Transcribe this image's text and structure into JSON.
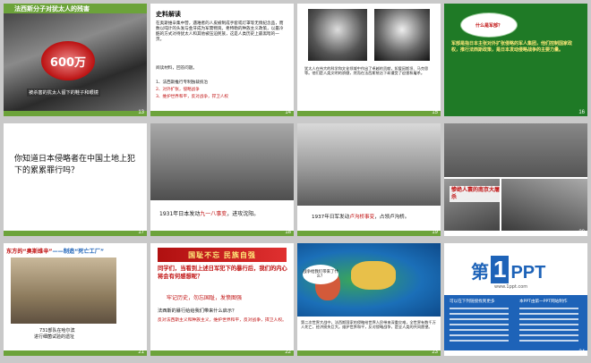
{
  "slides": [
    {
      "num": "13",
      "header": "法西斯分子对犹太人的残害",
      "badge": "600万",
      "caption": "被杀害的犹太人留下的鞋子和眼镜"
    },
    {
      "num": "14",
      "title": "史料解读",
      "para": "在奥斯维辛集中营，遇难者的人皮被制成手套或灯罩等无情纪念品，而数以吨计的头发与金牙成为军需物资。希特勒的种族主义政策，以最冷酷的方式对待犹太人和其他被压迫民族，这是人类历史上最黑暗的一页。",
      "question": "阅读材料，回答问题。",
      "items": [
        "1、法西斯推行专制独裁统治",
        "2、对外扩张，侵略战争",
        "3、维护世界和平，反对战争，捍卫人权"
      ]
    },
    {
      "num": "15",
      "para": "犹太人在伟大的科学和文化领域中作出了卓越的贡献，如爱因斯坦、马克思等。他们是人类文明的骄傲，然而在法西斯统治下却遭受了迫害和屠杀。"
    },
    {
      "num": "16",
      "bubble": "什么是军部？",
      "para": "军部是指日本主张对外扩张侵略的军人集团，他们控制国家政权，推行法西斯政策，是日本发动侵略战争的主要力量。"
    },
    {
      "num": "17",
      "text": "你知道日本侵略者在中国土地上犯下的累累罪行吗？"
    },
    {
      "num": "18",
      "caption_pre": "1931年日本发动",
      "caption_red": "九一八事变",
      "caption_post": "，进攻沈阳。"
    },
    {
      "num": "19",
      "caption_pre": "1937年日军发动",
      "caption_red": "卢沟桥事变",
      "caption_post": "，占领卢沟桥。"
    },
    {
      "num": "20",
      "label": "惨绝人寰的南京大屠杀"
    },
    {
      "num": "21",
      "title_a": "东方的“奥斯维辛”",
      "title_b": "——制造“死亡工厂”",
      "caption1": "731部队在哈尔滨",
      "caption2": "进行细菌试验的遗址"
    },
    {
      "num": "22",
      "banner": "国耻不忘 民族自强",
      "q1": "同学们，当看到上述日军犯下的暴行后，我们的内心将会有何感想呢？",
      "q2": "牢记历史，勿忘国耻，发愤图强",
      "q3": "法西斯的暴行给给我们带来什么启示？",
      "answer": "反对法西斯主义和种族主义，维护世界和平，反对战争，捍卫人权。"
    },
    {
      "num": "23",
      "bubble": "战争给我们带来了什么？",
      "para": "第二次世界大战中，法西斯国家的侵略给世界人民带来深重灾难，全世界有数千万人死亡，经济损失巨大。维护世界和平，反对侵略战争，是全人类的共同愿望。"
    },
    {
      "num": "24",
      "logo_a": "第",
      "logo_b": "1",
      "logo_c": "PPT",
      "site": "www.1ppt.com",
      "promo1": "可以在下列链接找到更多",
      "promo2": "本PPT由第一PPT网站制作"
    }
  ],
  "colors": {
    "green": "#6ca33a",
    "red": "#c01010",
    "page_bg": "#c9c9c9",
    "logo_blue": "#1e63b8"
  }
}
